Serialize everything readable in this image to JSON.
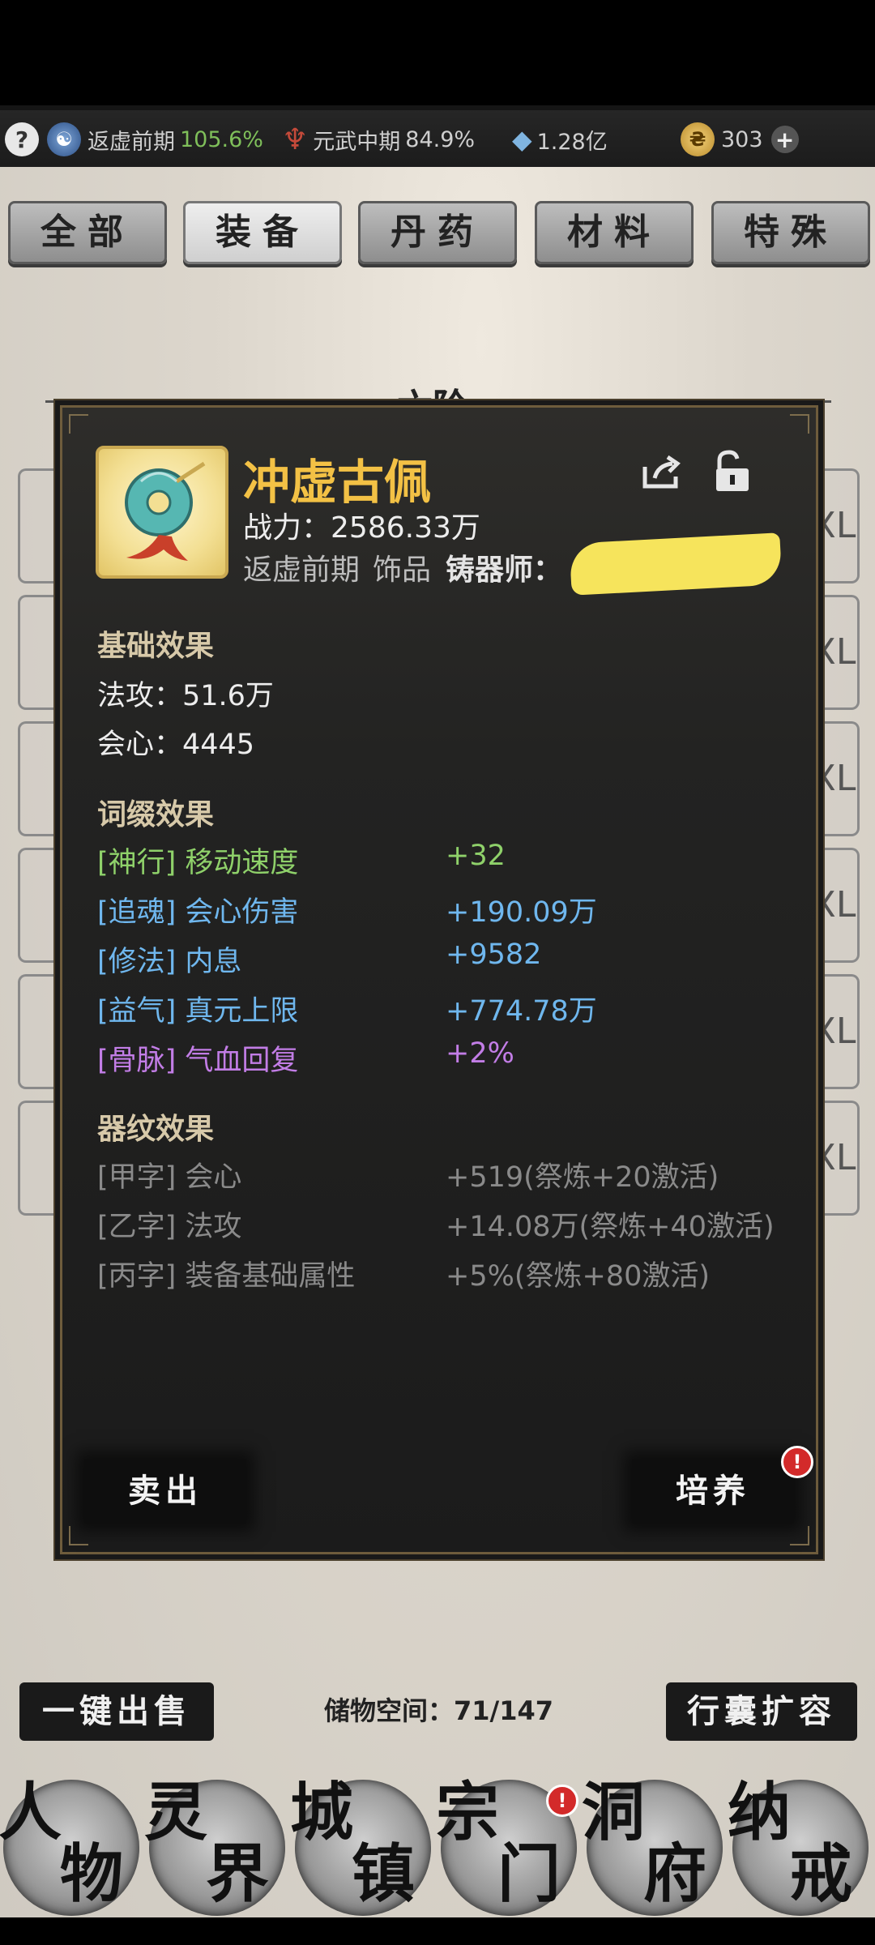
{
  "resources": {
    "realm_name": "返虚前期",
    "realm_percent": "105.6%",
    "martial_name": "元武中期",
    "martial_percent": "84.9%",
    "stones": "1.28亿",
    "currency": "303"
  },
  "tabs": [
    "全部",
    "装备",
    "丹药",
    "材料",
    "特殊"
  ],
  "active_tab": 1,
  "background_list": {
    "header": "六阶",
    "row_grade_labels": [
      "XL",
      "XL",
      "XL",
      "XL",
      "XL",
      "XL"
    ]
  },
  "item": {
    "name": "冲虚古佩",
    "power_label": "战力：",
    "power_value": "2586.33万",
    "realm": "返虚前期",
    "type": "饰品",
    "smith_label": "铸器师："
  },
  "basic_effects": {
    "title": "基础效果",
    "lines": [
      "法攻：51.6万",
      "会心：4445"
    ]
  },
  "affix_effects": {
    "title": "词缀效果",
    "rows": [
      {
        "name": "[神行] 移动速度",
        "value": "+32",
        "color": "#8fd16a"
      },
      {
        "name": "[追魂] 会心伤害",
        "value": "+190.09万",
        "color": "#6fb7ee"
      },
      {
        "name": "[修法] 内息",
        "value": "+9582",
        "color": "#6fb7ee"
      },
      {
        "name": "[益气] 真元上限",
        "value": "+774.78万",
        "color": "#6fb7ee"
      },
      {
        "name": "[骨脉] 气血回复",
        "value": "+2%",
        "color": "#c27de6"
      }
    ]
  },
  "pattern_effects": {
    "title": "器纹效果",
    "rows": [
      {
        "name": "[甲字] 会心",
        "value": "+519(祭炼+20激活)"
      },
      {
        "name": "[乙字] 法攻",
        "value": "+14.08万(祭炼+40激活)"
      },
      {
        "name": "[丙字] 装备基础属性",
        "value": "+5%(祭炼+80激活)"
      }
    ]
  },
  "actions": {
    "sell": "卖出",
    "cultivate": "培养",
    "alert": "!"
  },
  "footer": {
    "quick_sell": "一键出售",
    "storage_label": "储物空间：71/147",
    "expand": "行囊扩容"
  },
  "nav": [
    {
      "c1": "人",
      "c2": "物"
    },
    {
      "c1": "灵",
      "c2": "界"
    },
    {
      "c1": "城",
      "c2": "镇"
    },
    {
      "c1": "宗",
      "c2": "门"
    },
    {
      "c1": "洞",
      "c2": "府"
    },
    {
      "c1": "纳",
      "c2": "戒"
    }
  ],
  "nav_alert": "!",
  "icons": {
    "help": "help-icon",
    "realm": "yin-yang-icon",
    "martial": "flame-emblem-icon",
    "stone": "crystal-icon",
    "coin": "coin-icon",
    "plus": "plus-icon",
    "share": "share-icon",
    "lock": "unlock-icon"
  }
}
